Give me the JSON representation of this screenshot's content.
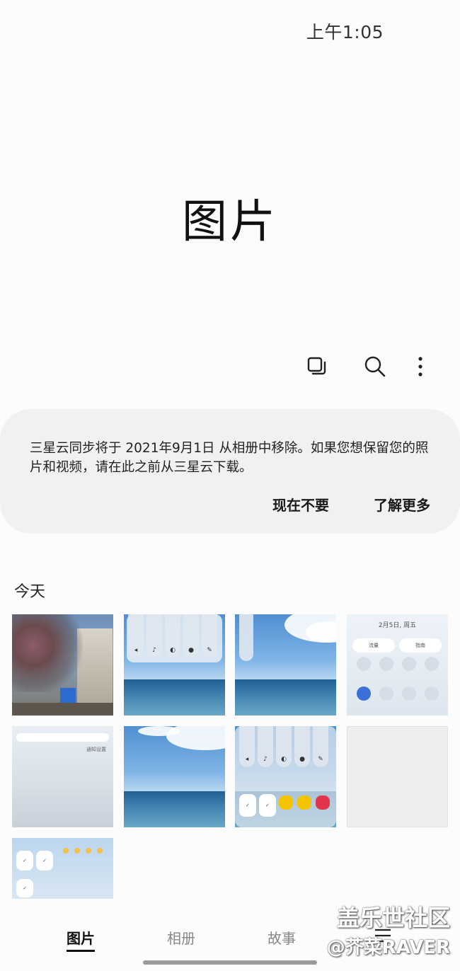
{
  "status": {
    "time": "上午1:05"
  },
  "header": {
    "title": "图片"
  },
  "toolbar": {
    "select_icon": "select-multiple-icon",
    "search_icon": "search-icon",
    "more_icon": "more-vertical-icon"
  },
  "banner": {
    "message": "三星云同步将于 2021年9月1日 从相册中移除。如果您想保留您的照片和视频，请在此之前从三星云下载。",
    "dismiss_label": "现在不要",
    "learn_more_label": "了解更多"
  },
  "section": {
    "label": "今天"
  },
  "thumbnails": {
    "t4_date": "2月5日, 周五",
    "t4_btn1": "流量",
    "t4_btn2": "指南",
    "t5_link": "通知设置"
  },
  "bottom_nav": {
    "items": [
      {
        "label": "图片",
        "active": true
      },
      {
        "label": "相册",
        "active": false
      },
      {
        "label": "故事",
        "active": false
      }
    ],
    "menu_icon": "menu-icon"
  },
  "watermark": {
    "line1": "盖乐世社区",
    "line2": "@芥菜RAVER"
  },
  "colors": {
    "background": "#fcfcfc",
    "banner_bg": "#f1f1f1",
    "text": "#1a1a1a",
    "nav_inactive": "#888888"
  }
}
